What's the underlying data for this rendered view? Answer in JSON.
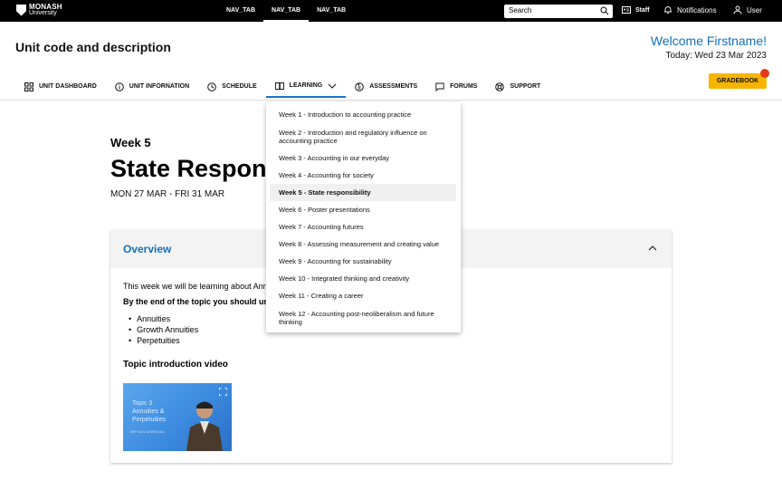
{
  "topbar": {
    "logo_line1": "MONASH",
    "logo_line2": "University",
    "nav_tabs": [
      "NAV_TAB",
      "NAV_TAB",
      "NAV_TAB"
    ],
    "search_placeholder": "Search",
    "staff_label": "Staff",
    "notifications_label": "Notifications",
    "user_label": "User"
  },
  "header": {
    "unit_title": "Unit code and description",
    "welcome": "Welcome Firstname!",
    "today": "Today: Wed 23 Mar 2023"
  },
  "subnav": {
    "items": [
      {
        "label": "UNIT DASHBOARD",
        "icon": "grid-icon"
      },
      {
        "label": "UNIT INFORNATION",
        "icon": "info-icon"
      },
      {
        "label": "SCHEDULE",
        "icon": "clock-icon"
      },
      {
        "label": "LEARNING",
        "icon": "book-icon"
      },
      {
        "label": "ASSESSMENTS",
        "icon": "assessment-icon"
      },
      {
        "label": "FORUMS",
        "icon": "chat-icon"
      },
      {
        "label": "SUPPORT",
        "icon": "lifebuoy-icon"
      }
    ],
    "active": "LEARNING",
    "gradebook_label": "GRADEBOOK"
  },
  "content": {
    "week_label": "Week 5",
    "week_title": "State Responsibility",
    "week_dates": "MON 27 MAR - FRI 31 MAR",
    "card": {
      "title": "Overview",
      "lead": "This week we will be learning about Annuities",
      "goal": "By the end of the topic you should understand",
      "bullets": [
        "Annuities",
        "Growth Annuities",
        "Perpetuities"
      ],
      "video_heading": "Topic introduction video",
      "video_text": "Topic 3 Annuities & Perpetuities",
      "video_code": "BFF1001 & BFB1001"
    }
  },
  "dropdown": {
    "items": [
      "Week 1 - Introduction to accounting practice",
      "Week 2 - Introduction and regulatory influence on accounting practice",
      "Week 3 - Accounting in our everyday",
      "Week 4 - Accounting for society",
      "Week 5 - State responsibility",
      "Week 6 - Poster presentations",
      "Week 7 - Accounting futures",
      "Week 8 - Assessing measurement and creating value",
      "Week 9 - Accounting for sustainability",
      "Week 10 - Integrated thinking and creativity",
      "Week 11 - Creating a career",
      "Week 12 - Accounting post-neoliberalism and future thinking"
    ],
    "selected_index": 4
  },
  "colors": {
    "accent": "#1470b8",
    "gradebook": "#f7b500",
    "notification_dot": "#e23b1a"
  }
}
